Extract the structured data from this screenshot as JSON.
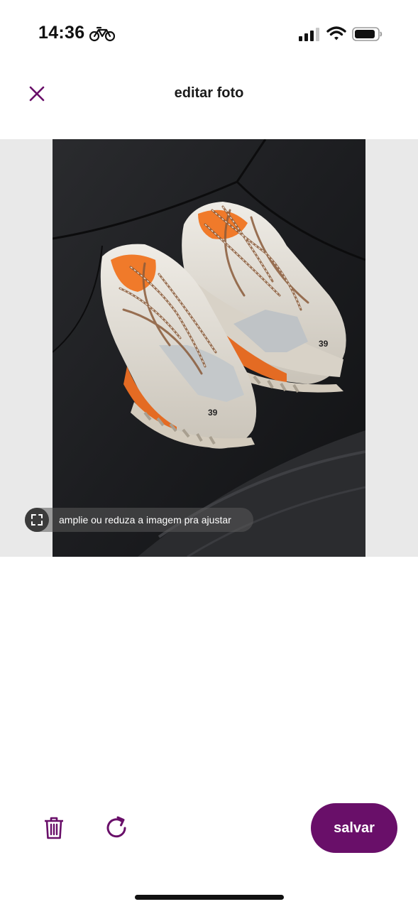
{
  "status_bar": {
    "time": "14:36",
    "activity_icon": "bicycle-icon",
    "signal_icon": "cellular-signal-icon",
    "wifi_icon": "wifi-icon",
    "battery_icon": "battery-icon"
  },
  "header": {
    "title": "editar foto",
    "close_icon": "close-icon"
  },
  "photo": {
    "alt": "foto de um par de tênis"
  },
  "hint": {
    "text": "amplie ou reduza a imagem pra ajustar",
    "icon": "resize-icon"
  },
  "toolbar": {
    "delete_icon": "trash-icon",
    "rotate_icon": "rotate-icon",
    "save_label": "salvar"
  },
  "colors": {
    "accent": "#690f69",
    "editor_bg": "#e9e9e9",
    "text": "#1a1a1a"
  }
}
